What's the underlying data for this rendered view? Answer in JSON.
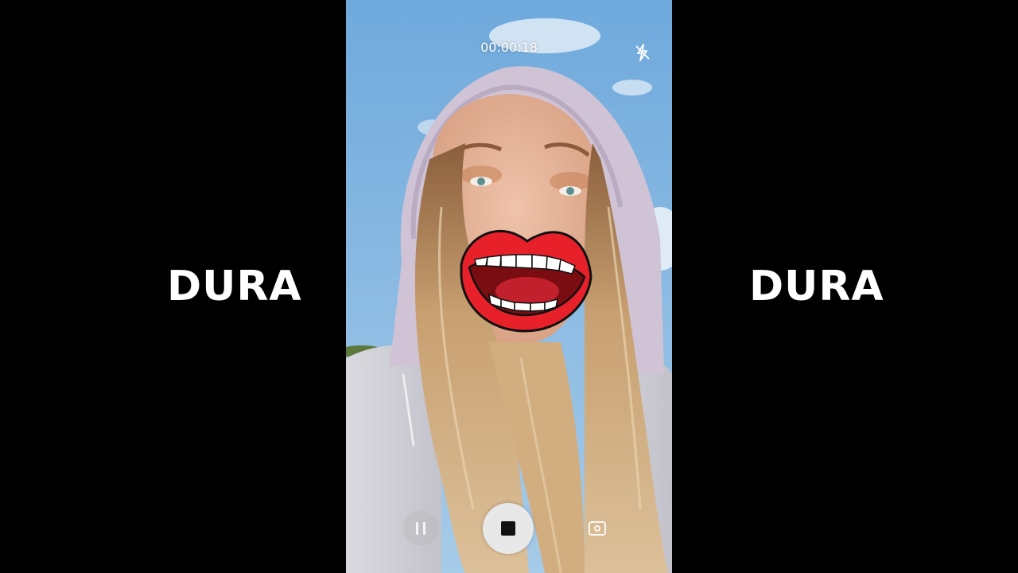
{
  "overlay": {
    "left_text": "DURA",
    "right_text": "DURA"
  },
  "camera": {
    "timer": "00:00:18",
    "flash_icon": "flash-off-icon",
    "controls": {
      "pause_icon": "pause-icon",
      "stop_icon": "stop-record-icon",
      "capture_icon": "camera-capture-icon"
    },
    "sticker": "lips-sticker"
  },
  "colors": {
    "background": "#000000",
    "sky": "#7db6e2",
    "hood": "#cdc0d4",
    "hair": "#c9a070",
    "lips": "#e8202a",
    "text": "#ffffff"
  }
}
